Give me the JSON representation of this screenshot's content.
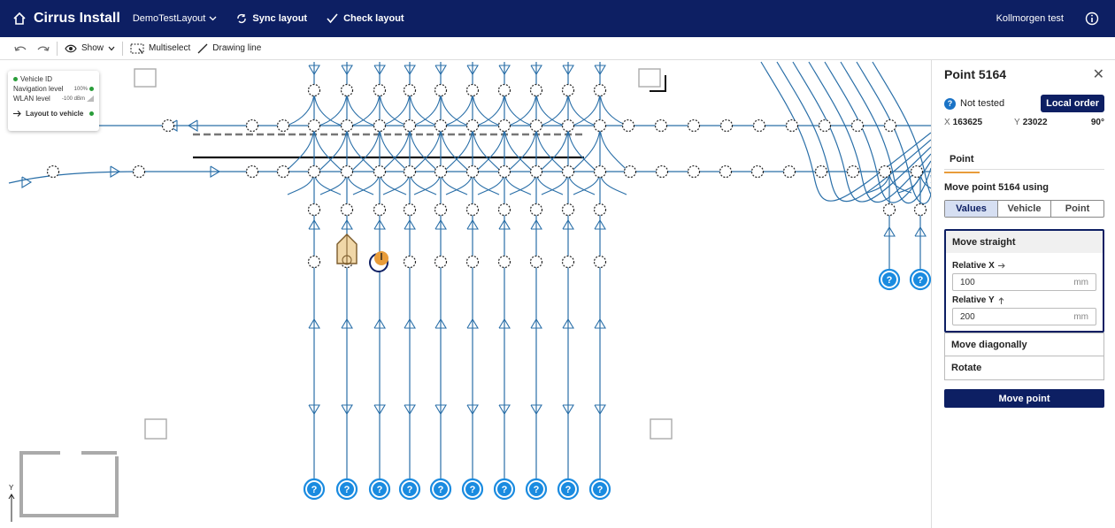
{
  "topbar": {
    "app_name": "Cirrus Install",
    "layout_name": "DemoTestLayout",
    "sync_label": "Sync layout",
    "check_label": "Check layout",
    "user": "Kollmorgen test"
  },
  "toolbar": {
    "show_label": "Show",
    "multiselect_label": "Multiselect",
    "drawing_line_label": "Drawing line"
  },
  "vehicle_panel": {
    "vehicle_id": "Vehicle ID",
    "nav_label": "Navigation level",
    "nav_value": "100%",
    "wlan_label": "WLAN level",
    "wlan_value": "-100 dBm",
    "layout_to_vehicle": "Layout to vehicle"
  },
  "canvas": {
    "axis_y_label": "Y",
    "marker_glyph": "?"
  },
  "panel": {
    "title": "Point 5164",
    "status": "Not tested",
    "local_order_label": "Local order",
    "x_label": "X",
    "x_value": "163625",
    "y_label": "Y",
    "y_value": "23022",
    "angle": "90°",
    "tab_point": "Point",
    "move_title": "Move point 5164 using",
    "segments": [
      "Values",
      "Vehicle",
      "Point"
    ],
    "move_straight": "Move straight",
    "rel_x_label": "Relative X",
    "rel_x_value": "100",
    "rel_y_label": "Relative Y",
    "rel_y_value": "200",
    "unit": "mm",
    "move_diagonally": "Move diagonally",
    "rotate": "Rotate",
    "move_point_button": "Move point"
  },
  "colors": {
    "nav_bar": "#0d1f63",
    "path_blue": "#2a6fa8",
    "marker_blue": "#1a8be0",
    "accent_orange": "#e89c3a",
    "status_green": "#2a9d3a"
  }
}
